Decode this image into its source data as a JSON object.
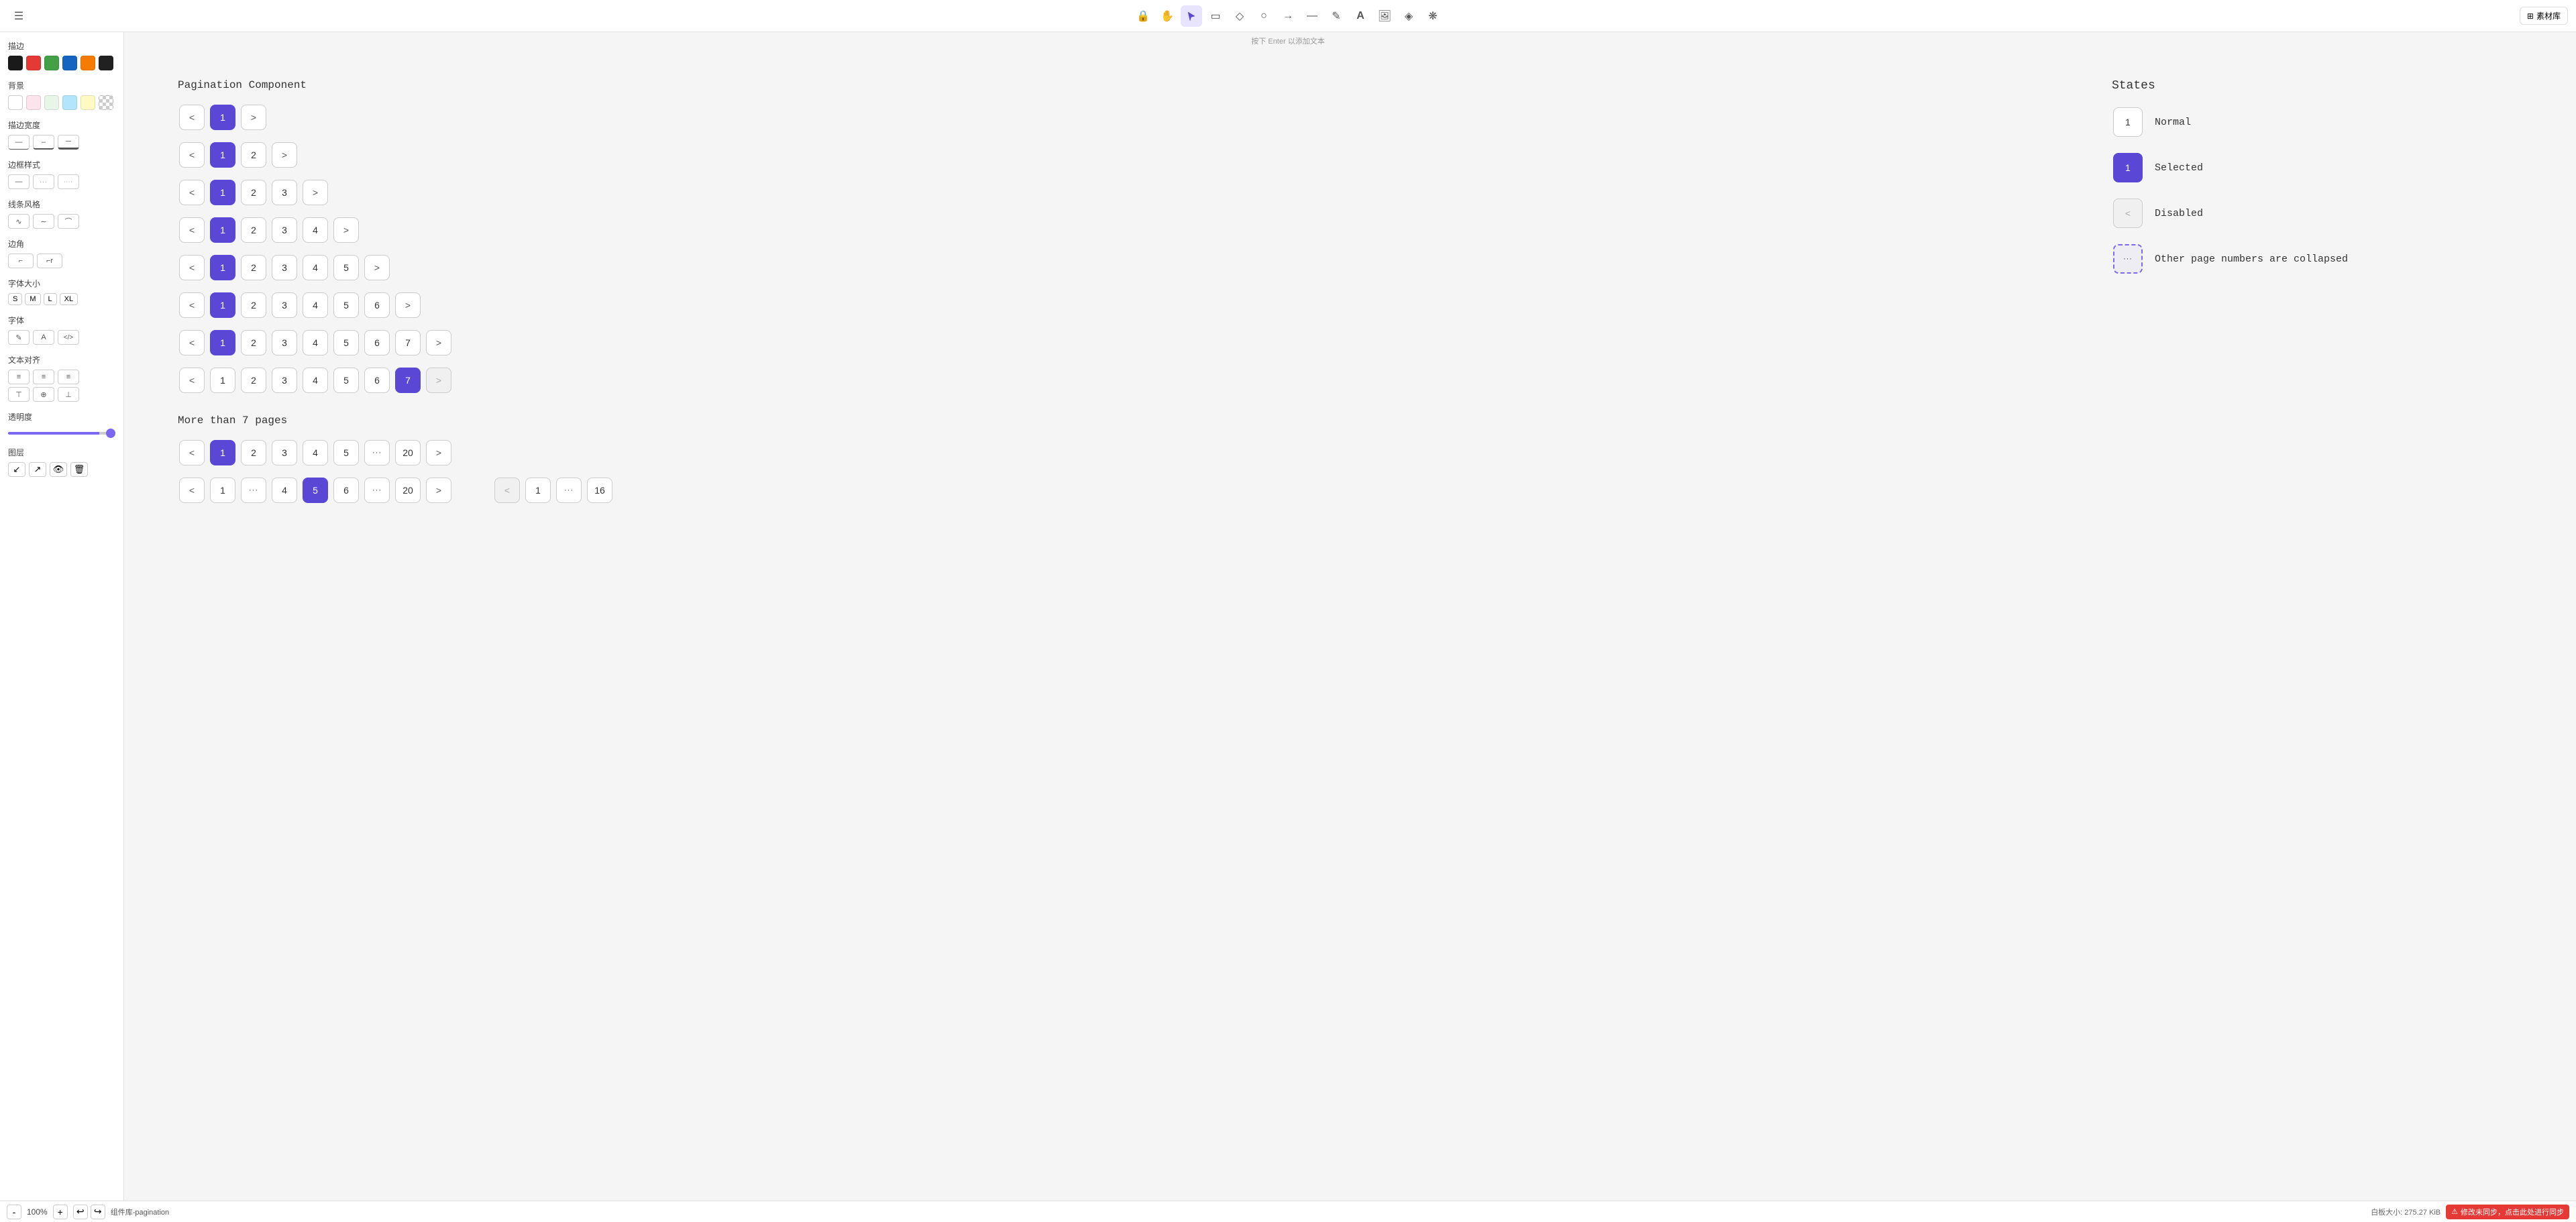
{
  "toolbar": {
    "menu_icon": "☰",
    "tools": [
      {
        "id": "lock",
        "icon": "🔒",
        "label": "lock-tool",
        "active": false
      },
      {
        "id": "hand",
        "icon": "✋",
        "label": "hand-tool",
        "active": false
      },
      {
        "id": "cursor",
        "icon": "↖",
        "label": "cursor-tool",
        "active": true
      },
      {
        "id": "rect",
        "icon": "▭",
        "label": "rect-tool",
        "active": false
      },
      {
        "id": "diamond",
        "icon": "◇",
        "label": "diamond-tool",
        "active": false
      },
      {
        "id": "circle",
        "icon": "○",
        "label": "circle-tool",
        "active": false
      },
      {
        "id": "arrow",
        "icon": "→",
        "label": "arrow-tool",
        "active": false
      },
      {
        "id": "line",
        "icon": "—",
        "label": "line-tool",
        "active": false
      },
      {
        "id": "pen",
        "icon": "✎",
        "label": "pen-tool",
        "active": false
      },
      {
        "id": "text",
        "icon": "A",
        "label": "text-tool",
        "active": false
      },
      {
        "id": "image",
        "icon": "🖼",
        "label": "image-tool",
        "active": false
      },
      {
        "id": "eraser",
        "icon": "◈",
        "label": "eraser-tool",
        "active": false
      },
      {
        "id": "component",
        "icon": "❋",
        "label": "component-tool",
        "active": false
      }
    ],
    "hint": "按下 Enter 以添加文本",
    "asset_btn": "素材库"
  },
  "sidebar": {
    "stroke_label": "描边",
    "stroke_colors": [
      "#1a1a1a",
      "#e53935",
      "#43a047",
      "#1565c0",
      "#f57c00",
      "#212121"
    ],
    "bg_label": "背景",
    "bg_colors": [
      "#ffffff",
      "#fce4ec",
      "#e8f5e9",
      "#e3f2fd",
      "#fff9c4",
      "transparent"
    ],
    "stroke_width_label": "描边宽度",
    "stroke_widths": [
      "—",
      "–",
      "─"
    ],
    "border_style_label": "边框样式",
    "border_styles": [
      "—",
      "···",
      "····"
    ],
    "line_style_label": "线条风格",
    "line_styles": [
      "∿",
      "∼",
      "⌒"
    ],
    "corner_label": "边角",
    "corners": [
      "⌐",
      "⌐r"
    ],
    "font_size_label": "字体大小",
    "font_sizes": [
      "S",
      "M",
      "L",
      "XL"
    ],
    "font_label": "字体",
    "font_styles": [
      "✎",
      "A",
      "</>"
    ],
    "text_align_label": "文本对齐",
    "text_aligns": [
      "≡l",
      "≡c",
      "≡r"
    ],
    "text_valign_label": "",
    "text_valigns": [
      "⊤",
      "⊕",
      "⊥"
    ],
    "transparency_label": "透明度",
    "transparency_value": 100,
    "layer_label": "图层",
    "layer_actions": [
      "↙",
      "↗",
      "👁",
      "🗑"
    ]
  },
  "bottom_bar": {
    "zoom_minus": "-",
    "zoom_level": "100%",
    "zoom_plus": "+",
    "undo": "↩",
    "redo": "↪",
    "canvas_name": "组件库-pagination",
    "page_size": "白板大小: 275.27 KiB",
    "sync_btn": "修改未同步，点击此处进行同步",
    "warning_icon": "⚠"
  },
  "canvas": {
    "section1_title": "Pagination Component",
    "states_title": "States",
    "state_normal": "Normal",
    "state_selected": "Selected",
    "state_disabled": "Disabled",
    "state_collapsed": "Other page numbers are collapsed",
    "section2_title": "More than 7 pages",
    "pagination_rows": [
      {
        "buttons": [
          {
            "t": "<",
            "s": "nav"
          },
          {
            "t": "1",
            "s": "selected"
          },
          {
            "t": ">",
            "s": "nav"
          }
        ]
      },
      {
        "buttons": [
          {
            "t": "<",
            "s": "nav"
          },
          {
            "t": "1",
            "s": "selected"
          },
          {
            "t": "2",
            "s": "normal"
          },
          {
            "t": ">",
            "s": "nav"
          }
        ]
      },
      {
        "buttons": [
          {
            "t": "<",
            "s": "nav"
          },
          {
            "t": "1",
            "s": "selected"
          },
          {
            "t": "2",
            "s": "normal"
          },
          {
            "t": "3",
            "s": "normal"
          },
          {
            "t": ">",
            "s": "nav"
          }
        ]
      },
      {
        "buttons": [
          {
            "t": "<",
            "s": "nav"
          },
          {
            "t": "1",
            "s": "selected"
          },
          {
            "t": "2",
            "s": "normal"
          },
          {
            "t": "3",
            "s": "normal"
          },
          {
            "t": "4",
            "s": "normal"
          },
          {
            "t": ">",
            "s": "nav"
          }
        ]
      },
      {
        "buttons": [
          {
            "t": "<",
            "s": "nav"
          },
          {
            "t": "1",
            "s": "selected"
          },
          {
            "t": "2",
            "s": "normal"
          },
          {
            "t": "3",
            "s": "normal"
          },
          {
            "t": "4",
            "s": "normal"
          },
          {
            "t": "5",
            "s": "normal"
          },
          {
            "t": ">",
            "s": "nav"
          }
        ]
      },
      {
        "buttons": [
          {
            "t": "<",
            "s": "nav"
          },
          {
            "t": "1",
            "s": "selected"
          },
          {
            "t": "2",
            "s": "normal"
          },
          {
            "t": "3",
            "s": "normal"
          },
          {
            "t": "4",
            "s": "normal"
          },
          {
            "t": "5",
            "s": "normal"
          },
          {
            "t": "6",
            "s": "normal"
          },
          {
            "t": ">",
            "s": "nav"
          }
        ]
      },
      {
        "buttons": [
          {
            "t": "<",
            "s": "nav"
          },
          {
            "t": "1",
            "s": "selected"
          },
          {
            "t": "2",
            "s": "normal"
          },
          {
            "t": "3",
            "s": "normal"
          },
          {
            "t": "4",
            "s": "normal"
          },
          {
            "t": "5",
            "s": "normal"
          },
          {
            "t": "6",
            "s": "normal"
          },
          {
            "t": "7",
            "s": "normal"
          },
          {
            "t": ">",
            "s": "nav"
          }
        ]
      },
      {
        "buttons": [
          {
            "t": "<",
            "s": "nav"
          },
          {
            "t": "1",
            "s": "normal"
          },
          {
            "t": "2",
            "s": "normal"
          },
          {
            "t": "3",
            "s": "normal"
          },
          {
            "t": "4",
            "s": "normal"
          },
          {
            "t": "5",
            "s": "normal"
          },
          {
            "t": "6",
            "s": "normal"
          },
          {
            "t": "7",
            "s": "selected"
          },
          {
            "t": ">",
            "s": "disabled"
          }
        ]
      }
    ],
    "more_rows": [
      {
        "buttons": [
          {
            "t": "<",
            "s": "nav"
          },
          {
            "t": "1",
            "s": "selected"
          },
          {
            "t": "2",
            "s": "normal"
          },
          {
            "t": "3",
            "s": "normal"
          },
          {
            "t": "4",
            "s": "normal"
          },
          {
            "t": "5",
            "s": "normal"
          },
          {
            "t": "...",
            "s": "collapsed"
          },
          {
            "t": "20",
            "s": "normal"
          },
          {
            "t": ">",
            "s": "nav"
          }
        ]
      },
      {
        "buttons": [
          {
            "t": "<",
            "s": "nav"
          },
          {
            "t": "1",
            "s": "normal"
          },
          {
            "t": "...",
            "s": "collapsed"
          },
          {
            "t": "4",
            "s": "normal"
          },
          {
            "t": "5",
            "s": "selected"
          },
          {
            "t": "6",
            "s": "normal"
          },
          {
            "t": "...",
            "s": "collapsed"
          },
          {
            "t": "20",
            "s": "normal"
          },
          {
            "t": ">",
            "s": "nav"
          }
        ]
      },
      {
        "buttons": [
          {
            "t": "<",
            "s": "disabled"
          },
          {
            "t": "1",
            "s": "normal"
          },
          {
            "t": "...",
            "s": "collapsed"
          },
          {
            "t": "16",
            "s": "normal"
          }
        ]
      }
    ]
  }
}
